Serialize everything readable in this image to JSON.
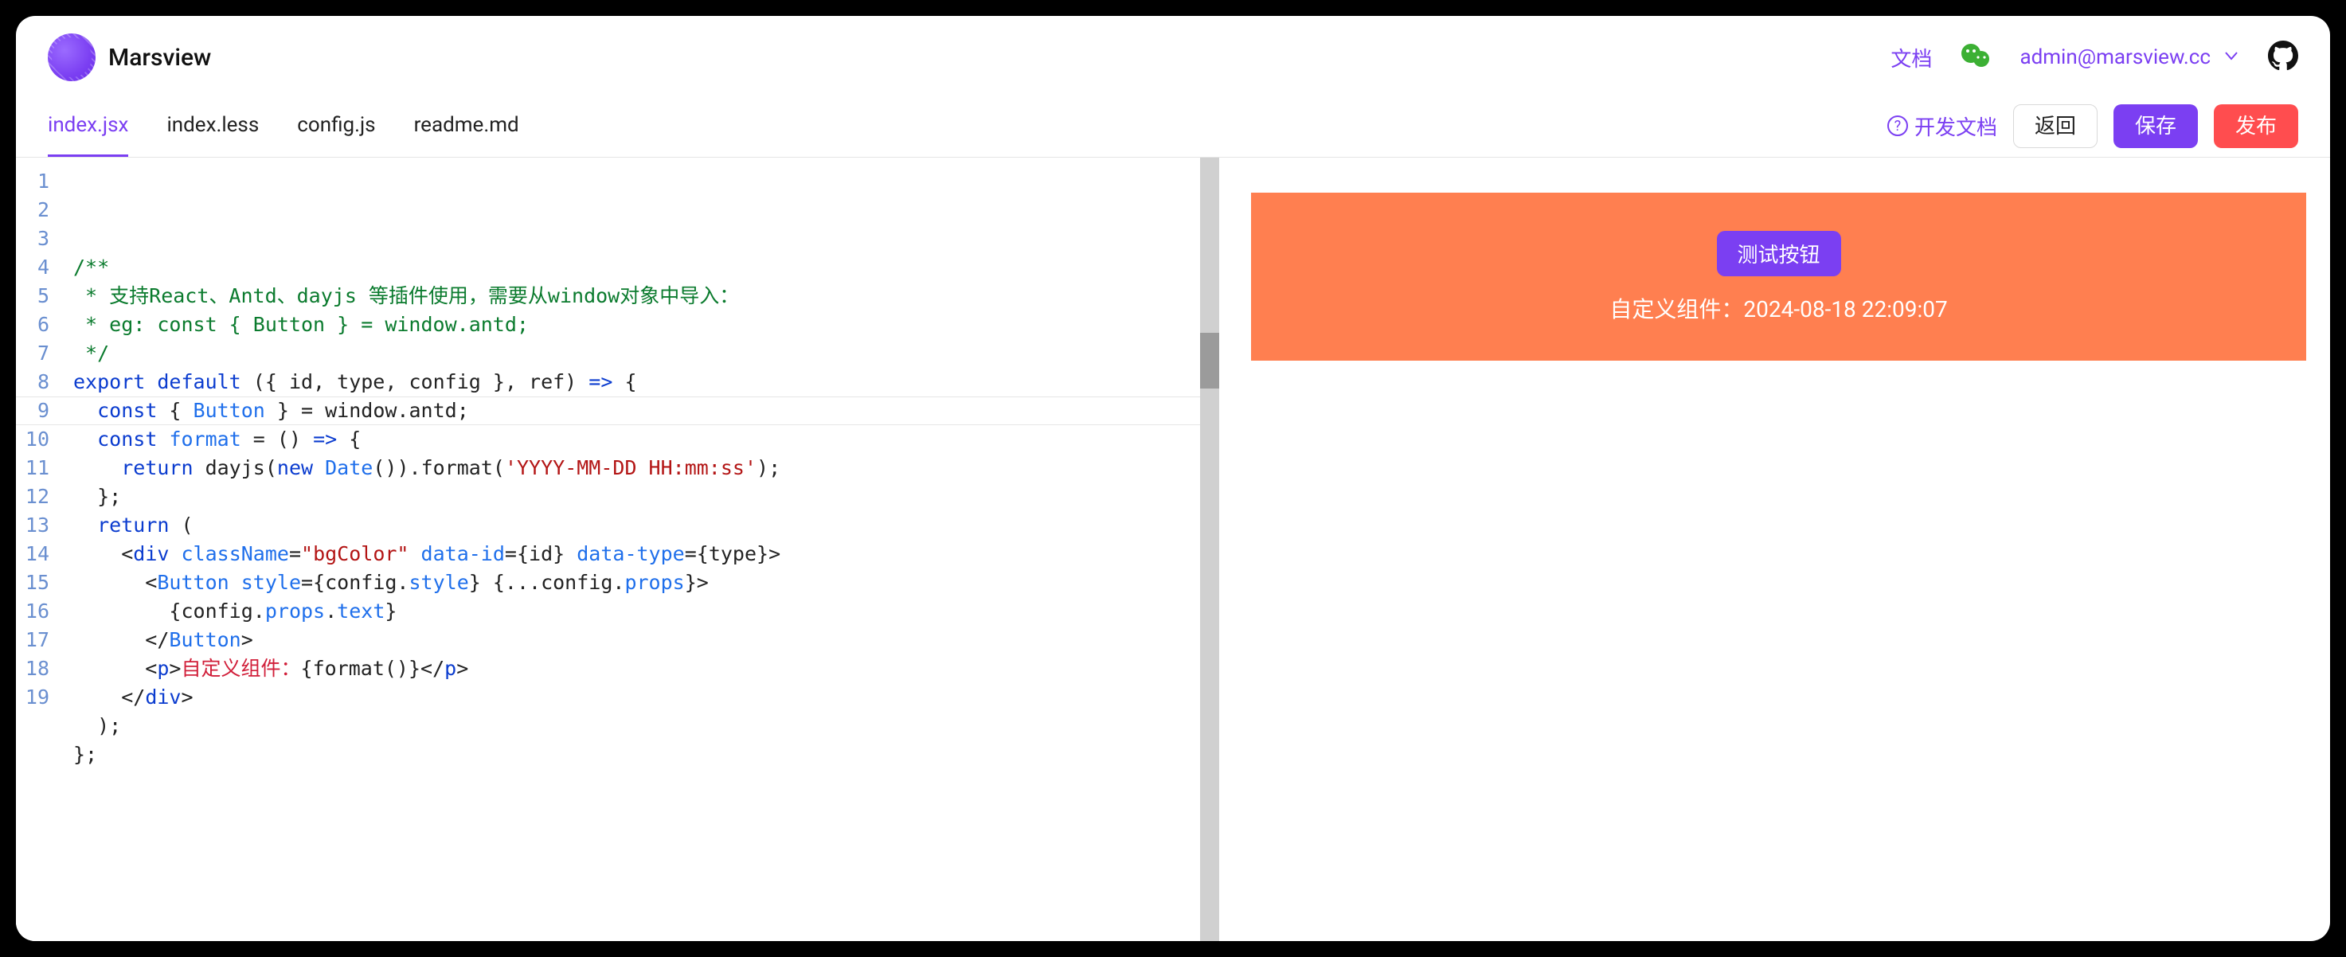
{
  "header": {
    "app_name": "Marsview",
    "docs_link": "文档",
    "user_email": "admin@marsview.cc"
  },
  "toolbar": {
    "tabs": [
      "index.jsx",
      "index.less",
      "config.js",
      "readme.md"
    ],
    "active_tab_index": 0,
    "dev_docs": "开发文档",
    "back": "返回",
    "save": "保存",
    "publish": "发布"
  },
  "editor": {
    "line_count": 19,
    "active_line": 9,
    "lines_raw": [
      "/**",
      " * 支持React、Antd、dayjs 等插件使用，需要从window对象中导入：",
      " * eg: const { Button } = window.antd;",
      " */",
      "export default ({ id, type, config }, ref) => {",
      "  const { Button } = window.antd;",
      "  const format = () => {",
      "    return dayjs(new Date()).format('YYYY-MM-DD HH:mm:ss');",
      "  };",
      "  return (",
      "    <div className=\"bgColor\" data-id={id} data-type={type}>",
      "      <Button style={config.style} {...config.props}>",
      "        {config.props.text}",
      "      </Button>",
      "      <p>自定义组件：{format()}</p>",
      "    </div>",
      "  );",
      "};",
      ""
    ]
  },
  "preview": {
    "button_label": "测试按钮",
    "caption_prefix": "自定义组件：",
    "timestamp": "2024-08-18 22:09:07",
    "bg_color": "#ff7f50",
    "accent_color": "#7b3ff2"
  }
}
